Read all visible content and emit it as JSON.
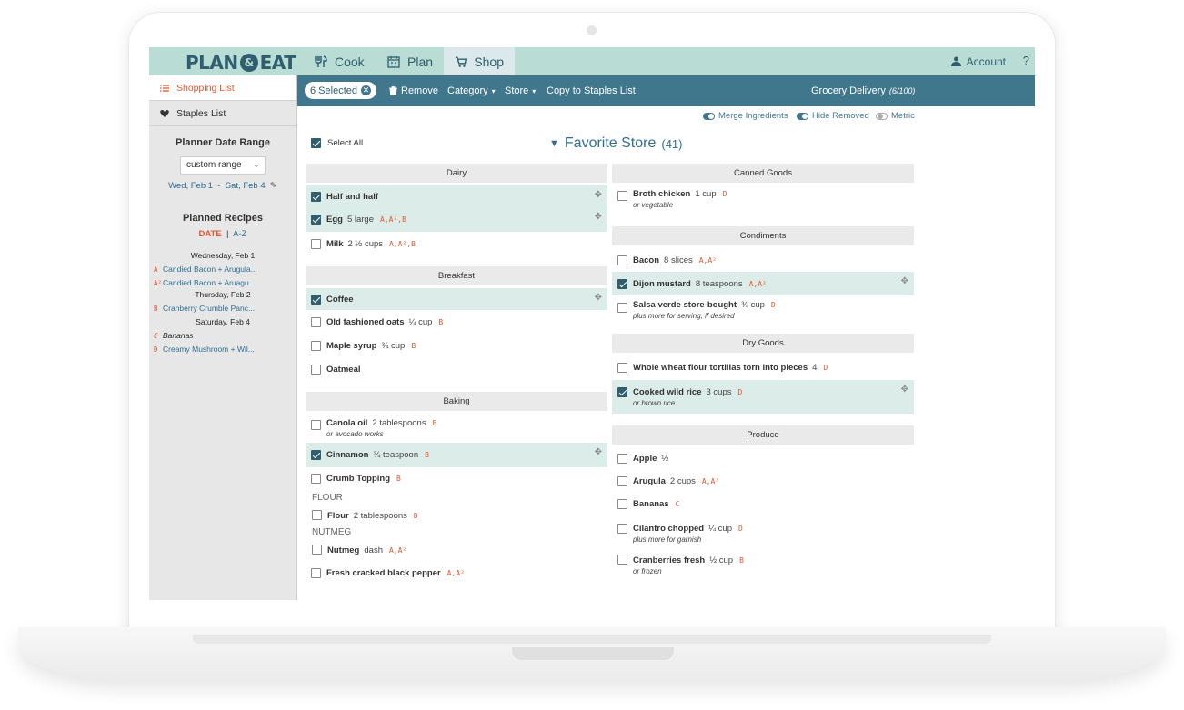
{
  "nav": {
    "logo_left": "PLAN",
    "logo_right": "EAT",
    "tabs": [
      {
        "label": "Cook"
      },
      {
        "label": "Plan"
      },
      {
        "label": "Shop"
      }
    ],
    "account_label": "Account",
    "help_label": "?"
  },
  "sidebar": {
    "shopping_list": "Shopping List",
    "staples_list": "Staples List",
    "date_range_heading": "Planner Date Range",
    "range_select_value": "custom range",
    "date_start": "Wed, Feb 1",
    "date_sep": "-",
    "date_end": "Sat, Feb 4",
    "planned_recipes_heading": "Planned Recipes",
    "sort_date": "DATE",
    "sort_sep": "|",
    "sort_az": "A-Z",
    "days": [
      {
        "label": "Wednesday, Feb 1"
      },
      {
        "label": "Thursday, Feb 2"
      },
      {
        "label": "Saturday, Feb 4"
      }
    ],
    "recipes": [
      {
        "tag": "A",
        "name": "Candied Bacon + Arugula..."
      },
      {
        "tag": "A²",
        "name": "Candied Bacon + Aruagu..."
      },
      {
        "tag": "B",
        "name": "Cranberry Crumble Panc..."
      },
      {
        "tag": "C",
        "name": "Bananas"
      },
      {
        "tag": "D",
        "name": "Creamy Mushroom + Wil..."
      }
    ]
  },
  "toolbar": {
    "selected_label": "6 Selected",
    "remove_label": "Remove",
    "category_label": "Category",
    "store_label": "Store",
    "copy_label": "Copy to Staples List",
    "delivery_label": "Grocery Delivery",
    "delivery_count": "(6/100)"
  },
  "options": {
    "merge": "Merge Ingredients",
    "hide_removed": "Hide Removed",
    "metric": "Metric"
  },
  "list": {
    "select_all": "Select All",
    "store_name": "Favorite Store",
    "store_count": "(41)",
    "left_categories": [
      {
        "name": "Dairy",
        "items": [
          {
            "name": "Half and half",
            "qty": "",
            "codes": "",
            "note": "",
            "checked": true
          },
          {
            "name": "Egg",
            "qty": "5 large",
            "codes": "A,A²,B",
            "note": "",
            "checked": true
          },
          {
            "name": "Milk",
            "qty": "2 ½ cups",
            "codes": "A,A²,B",
            "note": "",
            "checked": false
          }
        ]
      },
      {
        "name": "Breakfast",
        "items": [
          {
            "name": "Coffee",
            "qty": "",
            "codes": "",
            "note": "",
            "checked": true
          },
          {
            "name": "Old fashioned oats",
            "qty": "¼ cup",
            "codes": "B",
            "note": "",
            "checked": false
          },
          {
            "name": "Maple syrup",
            "qty": "¾ cup",
            "codes": "B",
            "note": "",
            "checked": false
          },
          {
            "name": "Oatmeal",
            "qty": "",
            "codes": "",
            "note": "",
            "checked": false
          }
        ]
      },
      {
        "name": "Baking",
        "items": [
          {
            "name": "Canola oil",
            "qty": "2 tablespoons",
            "codes": "B",
            "note": "or avocado works",
            "checked": false
          },
          {
            "name": "Cinnamon",
            "qty": "¾ teaspoon",
            "codes": "B",
            "note": "",
            "checked": true
          },
          {
            "name": "Crumb Topping",
            "qty": "",
            "codes": "B",
            "note": "",
            "checked": false
          }
        ],
        "subgroups": [
          {
            "label": "FLOUR",
            "item": {
              "name": "Flour",
              "qty": "2 tablespoons",
              "codes": "D"
            }
          },
          {
            "label": "NUTMEG",
            "item": {
              "name": "Nutmeg",
              "qty": "dash",
              "codes": "A,A²"
            }
          }
        ],
        "tail": [
          {
            "name": "Fresh cracked black pepper",
            "qty": "",
            "codes": "A,A²"
          }
        ]
      }
    ],
    "right_categories": [
      {
        "name": "Canned Goods",
        "items": [
          {
            "name": "Broth chicken",
            "qty": "1 cup",
            "codes": "D",
            "note": "or vegetable",
            "checked": false
          }
        ]
      },
      {
        "name": "Condiments",
        "items": [
          {
            "name": "Bacon",
            "qty": "8 slices",
            "codes": "A,A²",
            "note": "",
            "checked": false
          },
          {
            "name": "Dijon mustard",
            "qty": "8 teaspoons",
            "codes": "A,A²",
            "note": "",
            "checked": true
          },
          {
            "name": "Salsa verde store-bought",
            "qty": "¾ cup",
            "codes": "D",
            "note": "plus more for serving, if desired",
            "checked": false
          }
        ]
      },
      {
        "name": "Dry Goods",
        "items": [
          {
            "name": "Whole wheat flour tortillas torn into pieces",
            "qty": "4",
            "codes": "D",
            "note": "",
            "checked": false
          },
          {
            "name": "Cooked wild rice",
            "qty": "3 cups",
            "codes": "D",
            "note": "or brown rice",
            "checked": true
          }
        ]
      },
      {
        "name": "Produce",
        "items": [
          {
            "name": "Apple",
            "qty": "½",
            "codes": "",
            "note": "",
            "checked": false
          },
          {
            "name": "Arugula",
            "qty": "2 cups",
            "codes": "A,A²",
            "note": "",
            "checked": false
          },
          {
            "name": "Bananas",
            "qty": "",
            "codes": "C",
            "note": "",
            "checked": false
          },
          {
            "name": "Cilantro chopped",
            "qty": "¼ cup",
            "codes": "D",
            "note": "plus more for garnish",
            "checked": false
          },
          {
            "name": "Cranberries fresh",
            "qty": "½ cup",
            "codes": "B",
            "note": "or frozen",
            "checked": false
          }
        ]
      }
    ]
  },
  "colors": {
    "nav_bg": "#b9dcd5",
    "toolbar_bg": "#41778d",
    "accent": "#e4572e",
    "link": "#2f6f93",
    "selected_row": "#dcece8"
  }
}
